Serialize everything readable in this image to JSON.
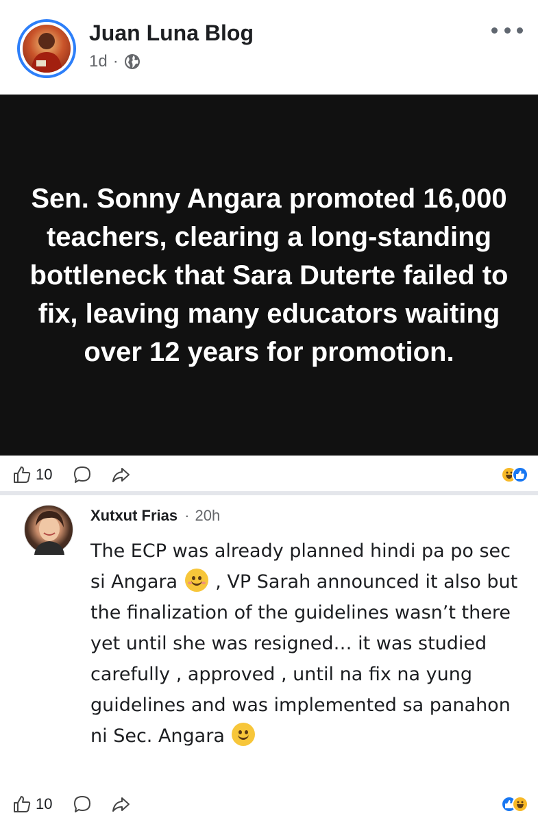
{
  "post": {
    "author": "Juan Luna Blog",
    "time": "1d",
    "separator": "·",
    "privacy_icon": "globe-icon",
    "image_text": "Sen. Sonny Angara promoted 16,000 teachers, clearing a long-standing bottleneck that Sara Duterte failed to fix, leaving many educators waiting over 12 years for promotion.",
    "like_count": "10",
    "reactions": [
      "haha",
      "like"
    ]
  },
  "comment": {
    "author": "Xutxut Frias",
    "separator": "·",
    "time": "20h",
    "text_part1": "The ECP was already planned hindi pa po sec si Angara ",
    "text_part2": " , VP Sarah announced it also but the finalization of the guidelines wasn’t there yet until she was resigned… it was studied carefully , approved , until na fix na yung guidelines and was implemented sa panahon ni Sec. Angara ",
    "like_count": "10",
    "reactions": [
      "like",
      "haha"
    ]
  },
  "colors": {
    "accent": "#2d7ff9",
    "image_bg": "#111111",
    "icon": "#606770"
  }
}
